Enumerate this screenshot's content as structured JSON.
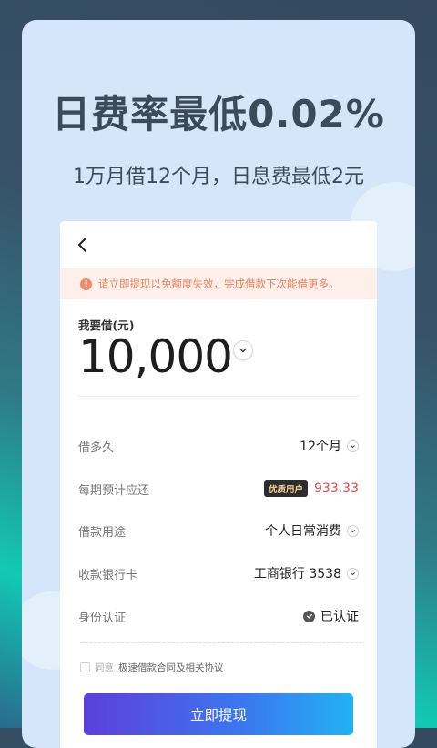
{
  "promo": {
    "headline": "日费率最低0.02%",
    "subline": "1万月借12个月，日息费最低2元"
  },
  "notice": {
    "icon": "warning-circle-icon",
    "text": "请立即提现以免额度失效，完成借款下次能借更多。"
  },
  "loan": {
    "amount_label": "我要借(元)",
    "amount": "10,000"
  },
  "form": {
    "term": {
      "label": "借多久",
      "value": "12个月"
    },
    "installment": {
      "label": "每期预计应还",
      "badge": "优质用户",
      "value": "933.33"
    },
    "purpose": {
      "label": "借款用途",
      "value": "个人日常消费"
    },
    "bank": {
      "label": "收款银行卡",
      "value": "工商银行 3538"
    },
    "identity": {
      "label": "身份认证",
      "value": "已认证"
    }
  },
  "agreement": {
    "prefix": "同意",
    "link": "极速借款合同及相关协议"
  },
  "cta": {
    "label": "立即提现"
  },
  "colors": {
    "accent_start": "#5d3fd9",
    "accent_end": "#22b2f2",
    "warning": "#ee7f5e",
    "price": "#e04c4c"
  }
}
